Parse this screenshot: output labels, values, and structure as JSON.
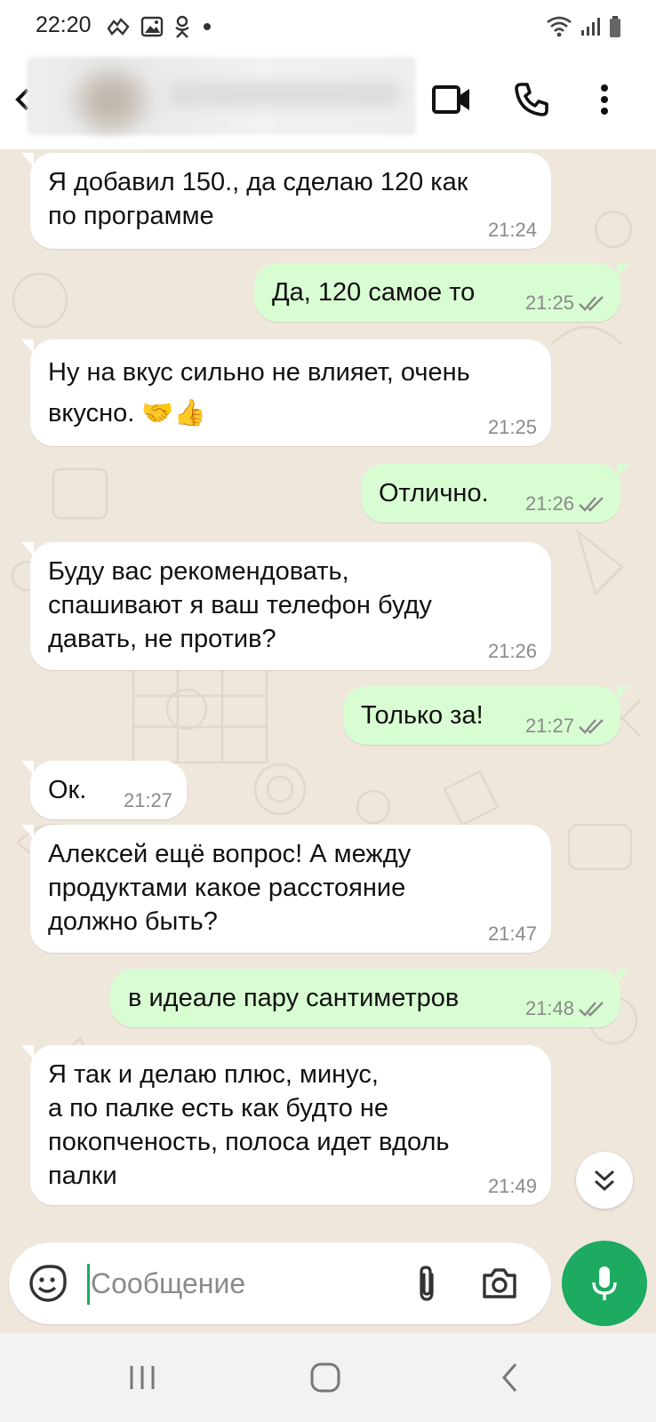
{
  "status_bar": {
    "time": "22:20"
  },
  "header": {
    "contact_name_blurred": true
  },
  "messages": [
    {
      "dir": "in",
      "text": "Я добавил 150., да сделаю 120 как\nпо программе",
      "time": "21:24"
    },
    {
      "dir": "out",
      "text": "Да, 120 самое то",
      "time": "21:25",
      "read": true
    },
    {
      "dir": "in",
      "text": "Ну на вкус сильно не влияет, очень\nвкусно. 🤝👍",
      "time": "21:25"
    },
    {
      "dir": "out",
      "text": "Отлично.",
      "time": "21:26",
      "read": true
    },
    {
      "dir": "in",
      "text": "Буду вас рекомендовать,\nспашивают я ваш телефон буду\nдавать, не против?",
      "time": "21:26"
    },
    {
      "dir": "out",
      "text": "Только за!",
      "time": "21:27",
      "read": true
    },
    {
      "dir": "in",
      "text": "Ок.",
      "time": "21:27"
    },
    {
      "dir": "in",
      "text": "Алексей ещё вопрос! А между\nпродуктами какое расстояние\nдолжно быть?",
      "time": "21:47"
    },
    {
      "dir": "out",
      "text": "в идеале пару сантиметров",
      "time": "21:48",
      "read": true
    },
    {
      "dir": "in",
      "text": "Я так и делаю плюс, минус,\nа по палке есть как будто не\nпокопченость, полоса идет вдоль\nпалки",
      "time": "21:49"
    }
  ],
  "composer": {
    "placeholder": "Сообщение",
    "value": ""
  },
  "icons": {
    "header": [
      "back-arrow-icon",
      "video-call-icon",
      "phone-icon",
      "more-vert-icon"
    ],
    "composer": [
      "sticker-icon",
      "attach-icon",
      "camera-icon",
      "mic-icon"
    ],
    "scroll": "chevrons-down-icon",
    "nav": [
      "recent-apps-icon",
      "home-icon",
      "back-icon"
    ]
  },
  "colors": {
    "incoming_bubble": "#ffffff",
    "outgoing_bubble": "#d9fdd3",
    "chat_background": "#efe7dc",
    "accent": "#1daa61",
    "read_ticks": "#8a8a8a"
  }
}
